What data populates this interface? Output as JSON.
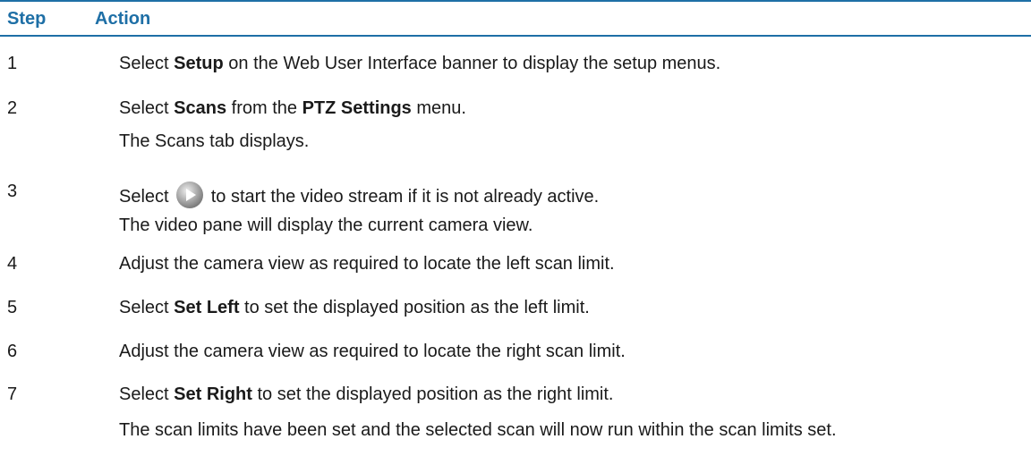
{
  "header": {
    "step": "Step",
    "action": "Action"
  },
  "steps": [
    {
      "number": "1",
      "lines": [
        {
          "pre": "Select ",
          "bold": "Setup",
          "post": " on the Web User Interface banner to display the setup menus."
        }
      ]
    },
    {
      "number": "2",
      "lines": [
        {
          "pre": "Select ",
          "bold": "Scans",
          "mid": " from the ",
          "bold2": "PTZ Settings",
          "post": " menu."
        },
        {
          "text": "The Scans tab displays."
        }
      ]
    },
    {
      "number": "3",
      "lines": [
        {
          "pre": "Select ",
          "icon": "play-icon",
          "post": " to start the video stream if it is not already active."
        },
        {
          "text": "The video pane will display the current camera view."
        }
      ]
    },
    {
      "number": "4",
      "lines": [
        {
          "text": "Adjust the camera view as required to locate the left scan limit."
        }
      ]
    },
    {
      "number": "5",
      "lines": [
        {
          "pre": "Select ",
          "bold": "Set Left",
          "post": " to set the displayed position as the left limit."
        }
      ]
    },
    {
      "number": "6",
      "lines": [
        {
          "text": "Adjust the camera view as required to locate the right scan limit."
        }
      ]
    },
    {
      "number": "7",
      "lines": [
        {
          "pre": "Select ",
          "bold": "Set Right",
          "post": " to set the displayed position as the right limit."
        },
        {
          "text": "The scan limits have been set and the selected scan will now run within the scan limits set."
        }
      ]
    }
  ]
}
